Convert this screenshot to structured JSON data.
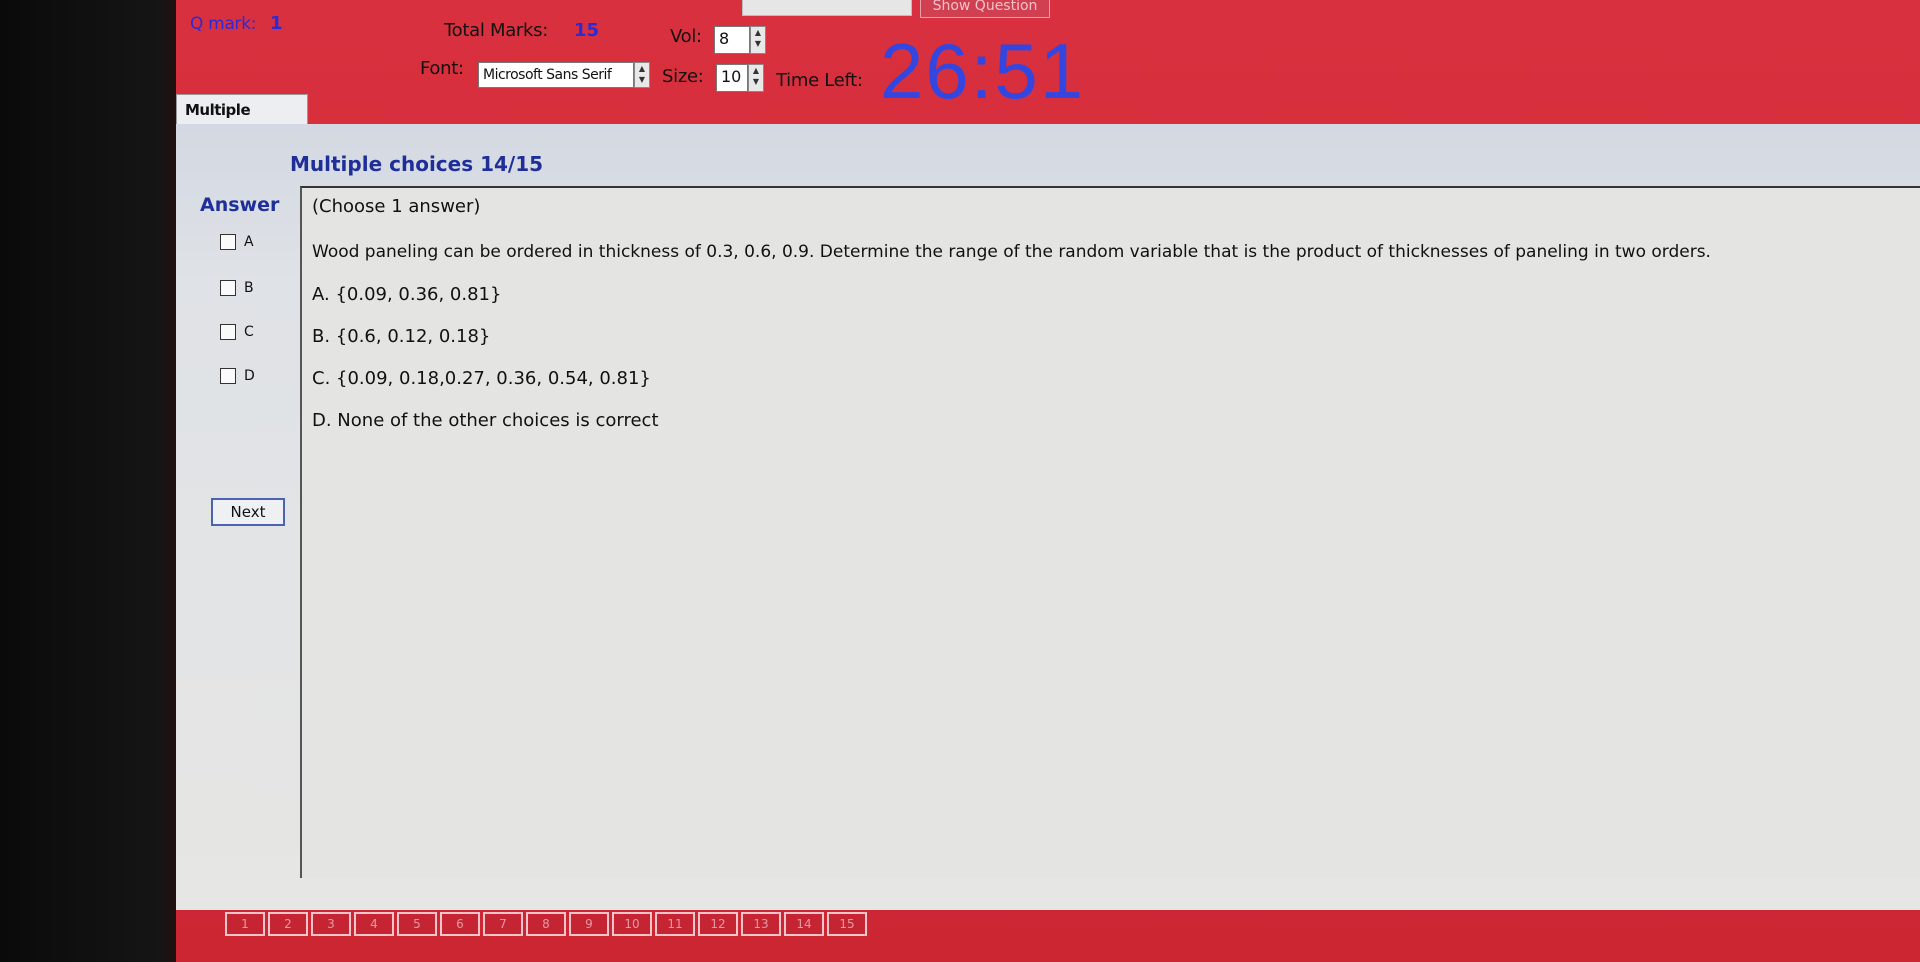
{
  "header": {
    "q_mark_label": "Q mark:",
    "q_mark_value": "1",
    "total_marks_label": "Total Marks:",
    "total_marks_value": "15",
    "vol_label": "Vol:",
    "vol_value": "8",
    "font_label": "Font:",
    "font_value": "Microsoft Sans Serif",
    "size_label": "Size:",
    "size_value": "10",
    "time_left_label": "Time Left:",
    "timer": "26:51",
    "show_question_label": "Show Question"
  },
  "tab": {
    "label": "Multiple Choices"
  },
  "main": {
    "section_title": "Multiple choices 14/15",
    "answer_label": "Answer",
    "answer_options": [
      "A",
      "B",
      "C",
      "D"
    ],
    "next_label": "Next"
  },
  "question": {
    "instruction": "(Choose 1 answer)",
    "text": "Wood paneling can be ordered in thickness of 0.3, 0.6, 0.9. Determine the range of the random variable that is the product of thicknesses of paneling in two orders.",
    "choices": [
      "A. {0.09, 0.36, 0.81}",
      "B. {0.6, 0.12, 0.18}",
      "C. {0.09, 0.18,0.27, 0.36, 0.54, 0.81}",
      "D. None of the other choices is correct"
    ]
  },
  "question_nav": [
    "1",
    "2",
    "3",
    "4",
    "5",
    "6",
    "7",
    "8",
    "9",
    "10",
    "11",
    "12",
    "13",
    "14",
    "15"
  ]
}
